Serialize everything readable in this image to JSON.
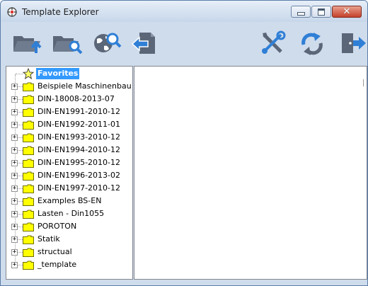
{
  "window": {
    "title": "Template Explorer"
  },
  "titlebar_buttons": [
    "minimize",
    "maximize",
    "close"
  ],
  "toolbar": {
    "buttons": [
      {
        "name": "folder-up-button",
        "icon": "folder-up-icon"
      },
      {
        "name": "folder-search-button",
        "icon": "folder-search-icon"
      },
      {
        "name": "web-search-button",
        "icon": "globe-search-icon"
      },
      {
        "name": "back-button",
        "icon": "document-back-arrow-icon"
      },
      {
        "name": "tools-button",
        "icon": "tools-icon"
      },
      {
        "name": "refresh-button",
        "icon": "refresh-icon"
      },
      {
        "name": "exit-button",
        "icon": "exit-door-icon"
      }
    ]
  },
  "tree": {
    "root": {
      "label": "Favorites",
      "icon": "star-icon",
      "selected": true
    },
    "items": [
      {
        "label": "Beispiele Maschinenbau"
      },
      {
        "label": "DIN-18008-2013-07"
      },
      {
        "label": "DIN-EN1991-2010-12"
      },
      {
        "label": "DIN-EN1992-2011-01"
      },
      {
        "label": "DIN-EN1993-2010-12"
      },
      {
        "label": "DIN-EN1994-2010-12"
      },
      {
        "label": "DIN-EN1995-2010-12"
      },
      {
        "label": "DIN-EN1996-2013-02"
      },
      {
        "label": "DIN-EN1997-2010-12"
      },
      {
        "label": "Examples BS-EN"
      },
      {
        "label": "Lasten - Din1055"
      },
      {
        "label": "POROTON"
      },
      {
        "label": "Statik"
      },
      {
        "label": "structual"
      },
      {
        "label": "_template"
      }
    ],
    "expander_glyph": "+"
  },
  "colors": {
    "selection": "#3399ff",
    "folder": "#ffff00",
    "toolbar_icon": "#5b6778",
    "toolbar_accent": "#2f7fd6"
  }
}
